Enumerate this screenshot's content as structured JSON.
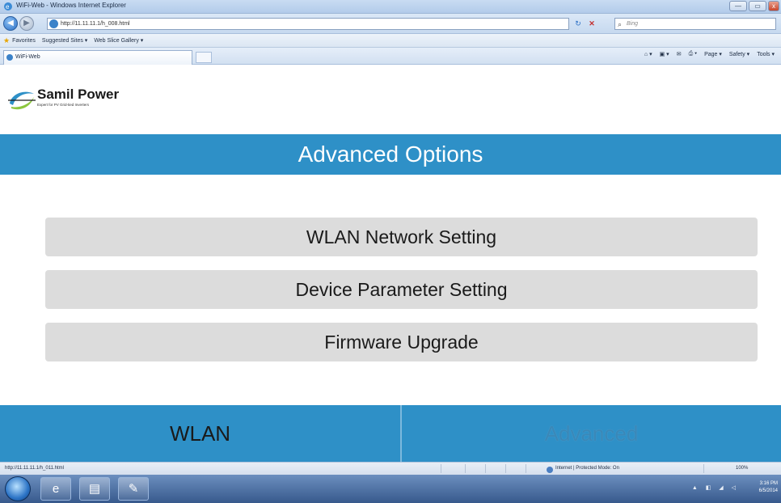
{
  "window": {
    "title": "WiFi-Web - Windows Internet Explorer",
    "minimize": "—",
    "maximize": "▭",
    "close": "x"
  },
  "addressbar": {
    "back": "◀",
    "forward": "▶",
    "url": "http://11.11.11.1/h_008.html",
    "refresh": "↻",
    "stop": "✕",
    "search_placeholder": "Bing",
    "search_icon": "⌕"
  },
  "favorites": {
    "label": "Favorites",
    "items": [
      "Suggested Sites ▾",
      "Web Slice Gallery ▾"
    ]
  },
  "tabs": {
    "active_tab": "WiFi-Web"
  },
  "commandbar": {
    "items": [
      "⌂ ▾",
      "▣ ▾",
      "✉",
      "⎙ ▾",
      "Page ▾",
      "Safety ▾",
      "Tools ▾"
    ]
  },
  "page": {
    "brand": "Samil Power",
    "tagline": "Expert for PV Grid-tied Inverters",
    "header": "Advanced Options",
    "options": [
      "WLAN Network Setting",
      "Device Parameter Setting",
      "Firmware Upgrade"
    ],
    "nav": {
      "wlan": "WLAN",
      "advanced": "Advanced"
    }
  },
  "statusbar": {
    "url": "http://11.11.11.1/h_011.html",
    "zone": "Internet | Protected Mode: On",
    "zoom": "100%"
  },
  "taskbar": {
    "time": "3:16 PM",
    "date": "6/5/2014",
    "tray": "▲ ◧ ◢ ◁"
  },
  "colors": {
    "accent": "#2e90c7",
    "option_bg": "#dcdcdc"
  }
}
